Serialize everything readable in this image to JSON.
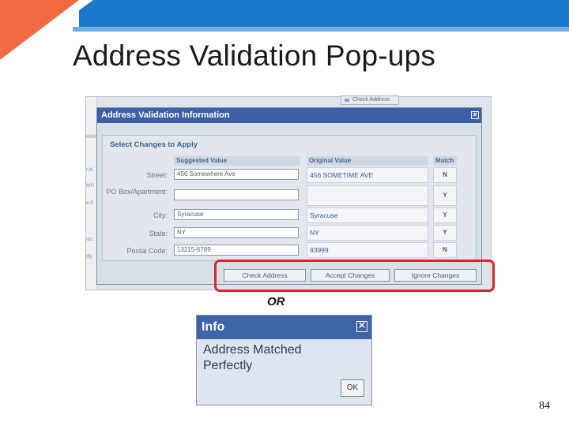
{
  "slide": {
    "title": "Address Validation Pop-ups",
    "or_label": "OR",
    "page_number": "84",
    "colors": {
      "top_bar_blue": "#1a78c8",
      "top_bar_light": "#6fb0e6",
      "accent_orange": "#f26a43",
      "highlight_red": "#e0202a"
    }
  },
  "background_screen": {
    "top_button_label": "Check Address",
    "left_strip_labels": [
      "HAN",
      "r-N",
      "M?I",
      "e S",
      "roc",
      "IS("
    ]
  },
  "validation_dialog": {
    "title": "Address Validation Information",
    "section_title": "Select Changes to Apply",
    "columns": {
      "suggested": "Suggested Value",
      "original": "Original Value",
      "match": "Match"
    },
    "rows": [
      {
        "label": "Street:",
        "suggested": "456 Somewhere Ave",
        "original": "456 SOMETIME AVE",
        "match": "N"
      },
      {
        "label": "PO Box/Apartment:",
        "suggested": "",
        "original": "",
        "match": "Y"
      },
      {
        "label": "City:",
        "suggested": "Syracuse",
        "original": "Syracuse",
        "match": "Y"
      },
      {
        "label": "State:",
        "suggested": "NY",
        "original": "NY",
        "match": "Y"
      },
      {
        "label": "Postal Code:",
        "suggested": "13215-6789",
        "original": "93999",
        "match": "N"
      }
    ],
    "buttons": {
      "check_address": "Check Address",
      "accept_changes": "Accept Changes",
      "ignore_changes": "Ignore Changes"
    }
  },
  "info_dialog": {
    "title": "Info",
    "message_line1": "Address Matched",
    "message_line2": "Perfectly",
    "ok_label": "OK"
  }
}
